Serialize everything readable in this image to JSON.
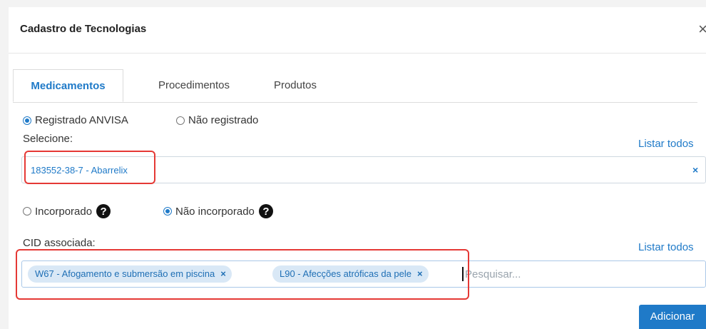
{
  "modal": {
    "title": "Cadastro de Tecnologias",
    "close_label": "×"
  },
  "tabs": [
    {
      "label": "Medicamentos",
      "active": true
    },
    {
      "label": "Procedimentos",
      "active": false
    },
    {
      "label": "Produtos",
      "active": false
    }
  ],
  "registration": {
    "options": [
      {
        "label": "Registrado ANVISA",
        "selected": true
      },
      {
        "label": "Não registrado",
        "selected": false
      }
    ]
  },
  "medication_select": {
    "label": "Selecione:",
    "list_all_label": "Listar todos",
    "selected_value": "183552-38-7 - Abarrelix",
    "clear_label": "×"
  },
  "incorporation": {
    "options": [
      {
        "label": "Incorporado",
        "selected": false
      },
      {
        "label": "Não incorporado",
        "selected": true
      }
    ],
    "help_label": "?"
  },
  "cid": {
    "label": "CID associada:",
    "list_all_label": "Listar todos",
    "chips": [
      {
        "label": "W67 - Afogamento e submersão em piscina",
        "remove": "×"
      },
      {
        "label": "L90 - Afecções atróficas da pele",
        "remove": "×"
      }
    ],
    "search_placeholder": "Pesquisar..."
  },
  "actions": {
    "add_label": "Adicionar"
  },
  "colors": {
    "accent": "#1f7ac8",
    "highlight": "#e53935",
    "chip_bg": "#d9e8f6"
  }
}
